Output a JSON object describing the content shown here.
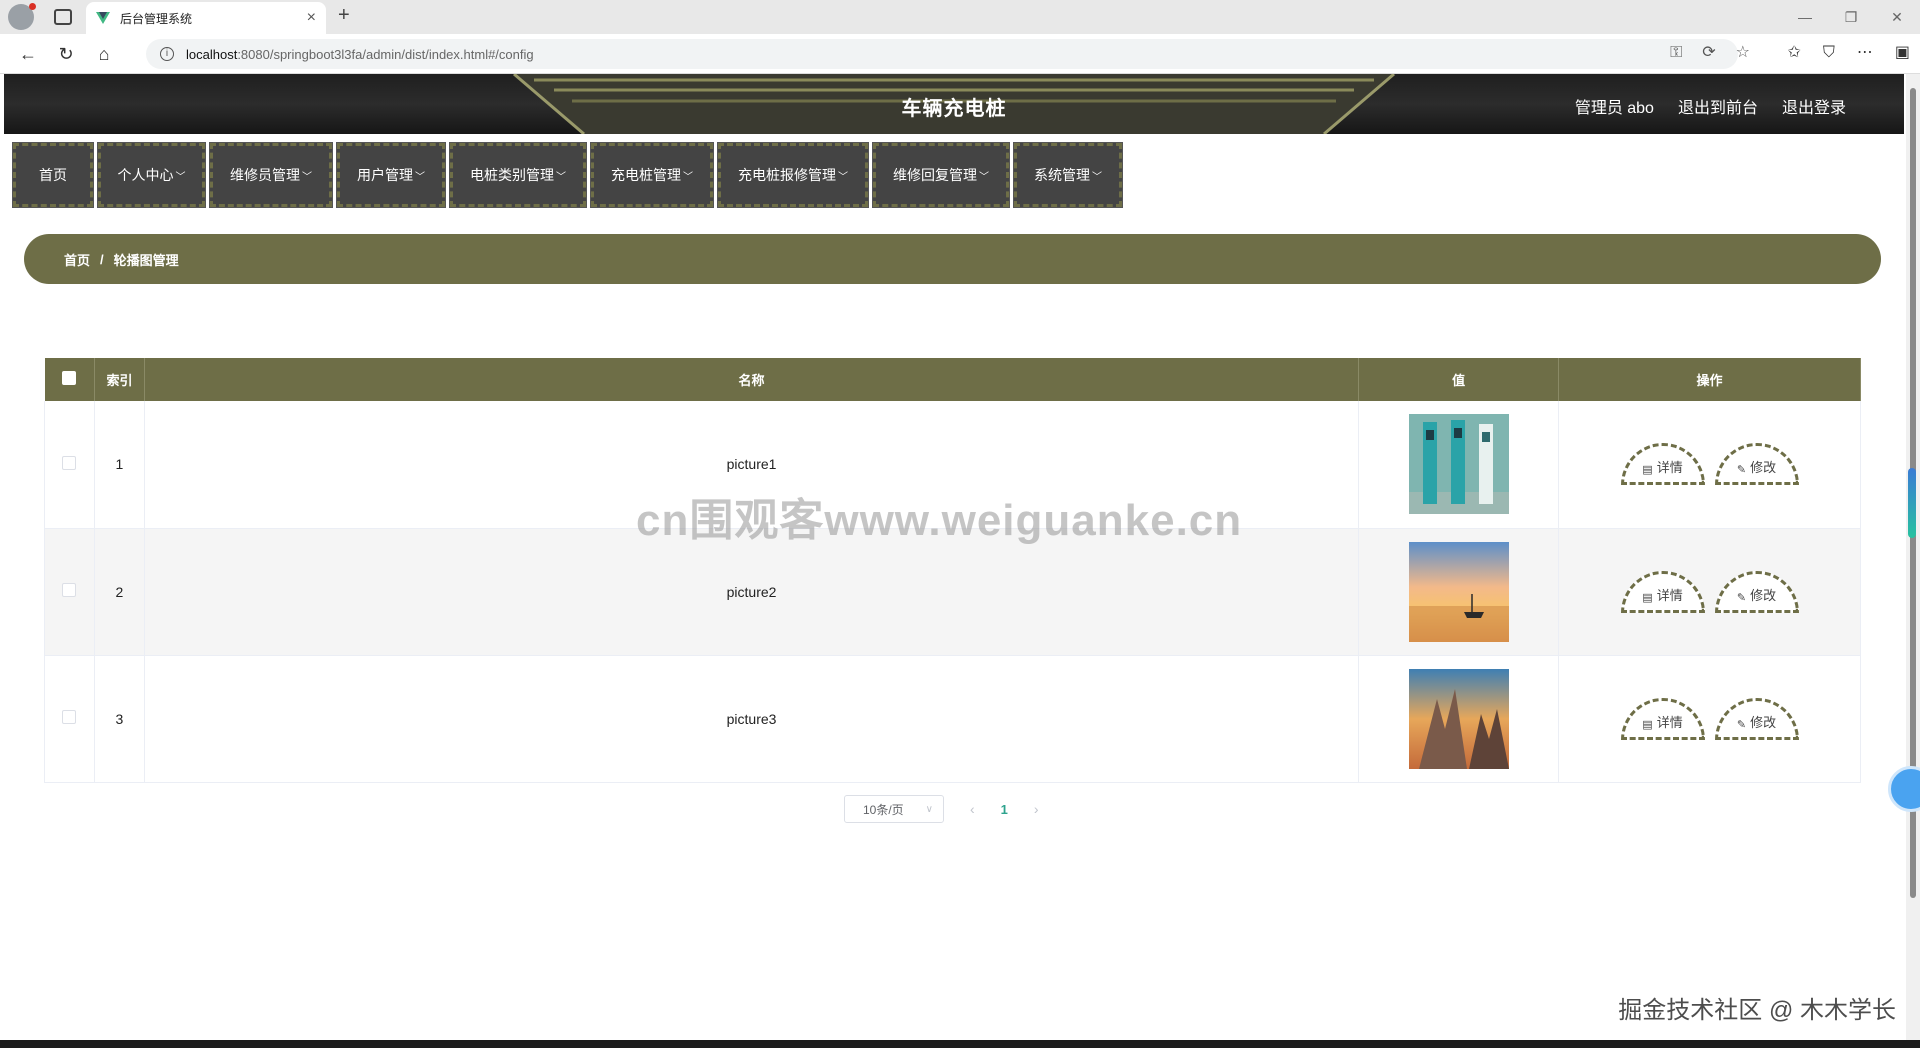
{
  "browser": {
    "tab_title": "后台管理系统",
    "url_host": "localhost",
    "url_path": ":8080/springboot3l3fa/admin/dist/index.html#/config"
  },
  "header": {
    "title": "车辆充电桩",
    "user_label": "管理员 abo",
    "front_link": "退出到前台",
    "logout_link": "退出登录"
  },
  "menu": {
    "items": [
      {
        "label": "首页",
        "has_dropdown": false
      },
      {
        "label": "个人中心",
        "has_dropdown": true
      },
      {
        "label": "维修员管理",
        "has_dropdown": true
      },
      {
        "label": "用户管理",
        "has_dropdown": true
      },
      {
        "label": "电桩类别管理",
        "has_dropdown": true
      },
      {
        "label": "充电桩管理",
        "has_dropdown": true
      },
      {
        "label": "充电桩报修管理",
        "has_dropdown": true
      },
      {
        "label": "维修回复管理",
        "has_dropdown": true
      },
      {
        "label": "系统管理",
        "has_dropdown": true
      }
    ]
  },
  "breadcrumb": {
    "home": "首页",
    "separator": "/",
    "current": "轮播图管理"
  },
  "table": {
    "columns": [
      "索引",
      "名称",
      "值",
      "操作"
    ],
    "rows": [
      {
        "index": "1",
        "name": "picture1",
        "image": "charging-stations-photo"
      },
      {
        "index": "2",
        "name": "picture2",
        "image": "sunset-boat-photo"
      },
      {
        "index": "3",
        "name": "picture3",
        "image": "mountain-peaks-photo"
      }
    ],
    "detail_label": "详情",
    "edit_label": "修改"
  },
  "pagination": {
    "page_size": "10条/页",
    "current_page": "1"
  },
  "watermarks": {
    "center": "cn围观客www.weiguanke.cn",
    "corner": "掘金技术社区 @ 木木学长"
  },
  "colors": {
    "accent": "#6e6e47",
    "header_bg": "#2a2a2a",
    "menu_bg": "#444444",
    "active_page": "#2ea38e"
  }
}
